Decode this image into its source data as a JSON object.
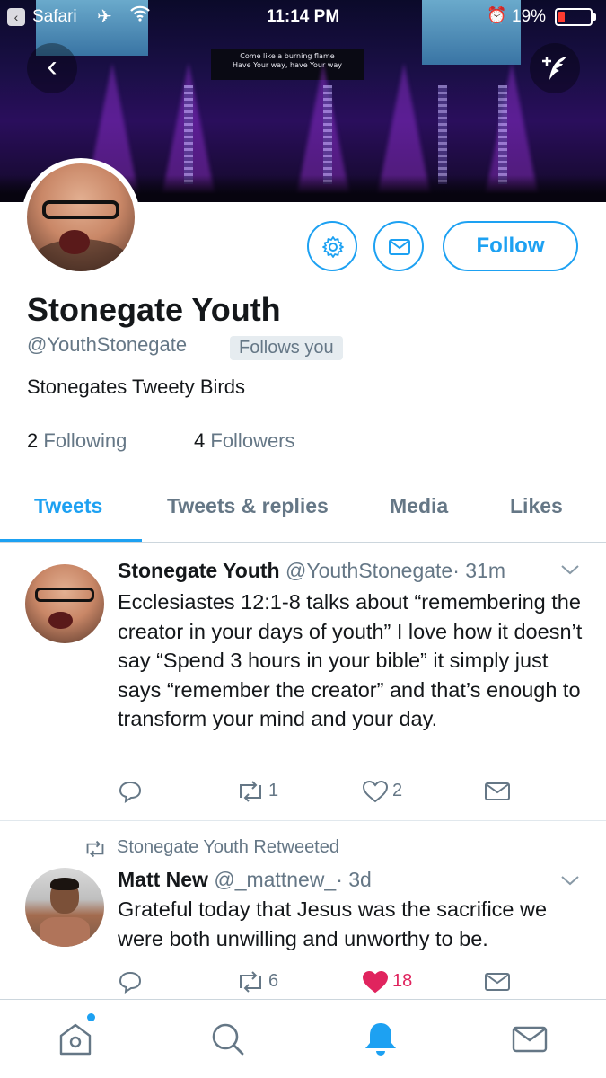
{
  "status_bar": {
    "back_app": "Safari",
    "time": "11:14 PM",
    "battery": "19%",
    "battery_color": "#ff3b30"
  },
  "banner": {
    "lyrics_line1": "Come like a burning flame",
    "lyrics_line2": "Have Your way, have Your way"
  },
  "profile": {
    "name": "Stonegate Youth",
    "handle": "@YouthStonegate",
    "follows_you": "Follows you",
    "bio": "Stonegates Tweety Birds",
    "following_count": "2",
    "following_label": "Following",
    "followers_count": "4",
    "followers_label": "Followers",
    "follow_button": "Follow"
  },
  "tabs": {
    "items": [
      {
        "label": "Tweets",
        "active": true
      },
      {
        "label": "Tweets & replies",
        "active": false
      },
      {
        "label": "Media",
        "active": false
      },
      {
        "label": "Likes",
        "active": false
      }
    ]
  },
  "tweets": [
    {
      "author": "Stonegate Youth",
      "handle": "@YouthStonegate",
      "time": "· 31m",
      "text": "Ecclesiastes 12:1-8 talks about “remembering the creator in your days of youth” I love how it doesn’t say “Spend 3 hours in your bible” it simply just says “remember the creator” and that’s enough to transform your mind and your day.",
      "retweets": "1",
      "likes": "2"
    },
    {
      "retweeted_by": "Stonegate Youth Retweeted",
      "author": "Matt New",
      "handle": "@_mattnew_",
      "time": "· 3d",
      "text": "Grateful today that Jesus was the sacrifice we were both unwilling and unworthy to be.",
      "retweets": "6",
      "likes": "18",
      "liked": true
    }
  ],
  "colors": {
    "accent": "#1da1f2",
    "like": "#e0245e",
    "secondary_text": "#657786"
  },
  "icons": {
    "back": "chevron-left-icon",
    "compose": "compose-tweet-icon",
    "settings": "gear-icon",
    "message": "envelope-icon",
    "reply": "reply-icon",
    "retweet": "retweet-icon",
    "like": "heart-icon",
    "tab_home": "home-icon",
    "tab_search": "search-icon",
    "tab_notifications": "bell-icon",
    "tab_messages": "envelope-icon"
  }
}
